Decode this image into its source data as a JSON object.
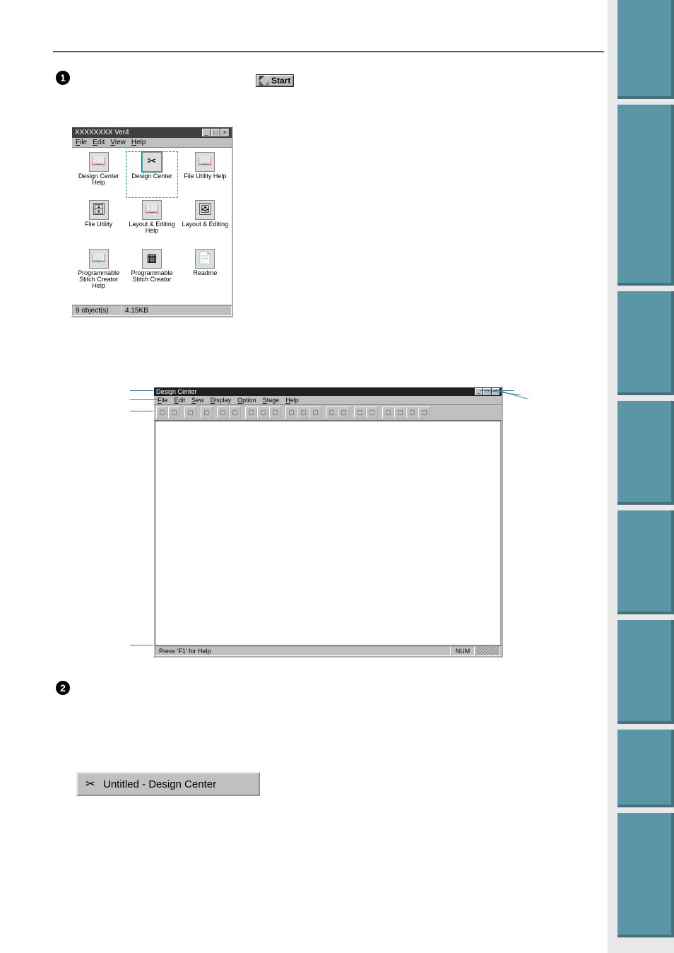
{
  "bullets": {
    "one": "1",
    "two": "2"
  },
  "start_button": {
    "label": "Start"
  },
  "explorer": {
    "title": "XXXXXXXX Ver4",
    "menu": [
      "File",
      "Edit",
      "View",
      "Help"
    ],
    "icons": [
      {
        "label": "Design Center Help"
      },
      {
        "label": "Design Center"
      },
      {
        "label": "File Utility Help"
      },
      {
        "label": "File Utility"
      },
      {
        "label": "Layout & Editing Help"
      },
      {
        "label": "Layout & Editing"
      },
      {
        "label": "Programmable Stitch Creator Help"
      },
      {
        "label": "Programmable Stitch Creator"
      },
      {
        "label": "Readme"
      }
    ],
    "status": {
      "objects": "9 object(s)",
      "size": "4.15KB"
    },
    "window_controls": {
      "min": "_",
      "max": "□",
      "close": "×"
    }
  },
  "design_center": {
    "title": "Design Center",
    "menu": [
      "File",
      "Edit",
      "Sew",
      "Display",
      "Option",
      "Stage",
      "Help"
    ],
    "status_help": "Press 'F1' for Help",
    "status_right": "NUM",
    "window_controls": {
      "min": "_",
      "max": "□",
      "close": "×"
    }
  },
  "taskbar_button": "Untitled - Design Center"
}
